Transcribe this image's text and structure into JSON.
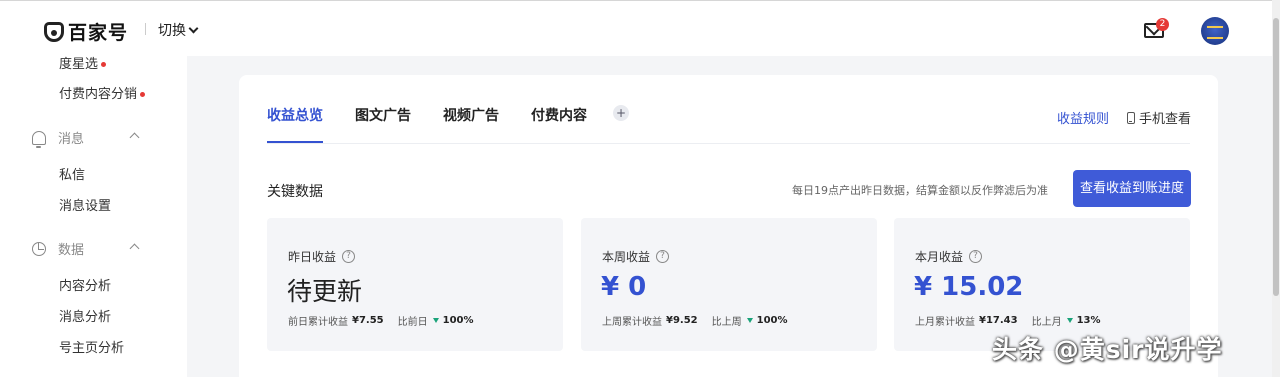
{
  "header": {
    "logo_text": "百家号",
    "switch_label": "切换",
    "mail_badge": "2"
  },
  "sidebar": {
    "items_top": [
      {
        "label": "度星选"
      },
      {
        "label": "付费内容分销"
      }
    ],
    "groups": [
      {
        "label": "消息",
        "icon": "bell-icon",
        "items": [
          {
            "label": "私信"
          },
          {
            "label": "消息设置"
          }
        ]
      },
      {
        "label": "数据",
        "icon": "pie-chart-icon",
        "items": [
          {
            "label": "内容分析"
          },
          {
            "label": "消息分析"
          },
          {
            "label": "号主页分析"
          }
        ]
      }
    ]
  },
  "main": {
    "tabs": [
      {
        "label": "收益总览",
        "active": true
      },
      {
        "label": "图文广告"
      },
      {
        "label": "视频广告"
      },
      {
        "label": "付费内容"
      }
    ],
    "add_tab_symbol": "+",
    "rules_link": "收益规则",
    "phone_view": "手机查看",
    "key_data_title": "关键数据",
    "key_data_note": "每日19点产出昨日数据，结算金额以反作弊滤后为准",
    "progress_button": "查看收益到账进度",
    "stats": [
      {
        "label": "昨日收益",
        "value": "待更新",
        "foot_label": "前日累计收益",
        "foot_value": "¥7.55",
        "compare_label": "比前日",
        "compare_value": "100%"
      },
      {
        "label": "本周收益",
        "value": "¥ 0",
        "foot_label": "上周累计收益",
        "foot_value": "¥9.52",
        "compare_label": "比上周",
        "compare_value": "100%"
      },
      {
        "label": "本月收益",
        "value": "¥ 15.02",
        "foot_label": "上月累计收益",
        "foot_value": "¥17.43",
        "compare_label": "比上月",
        "compare_value": "13%"
      }
    ]
  },
  "watermark": "头条 @黄sir说升学",
  "colors": {
    "accent": "#3452d1",
    "button": "#3f5bd8",
    "badge": "#e53935",
    "down_trend": "#1aa37a"
  }
}
